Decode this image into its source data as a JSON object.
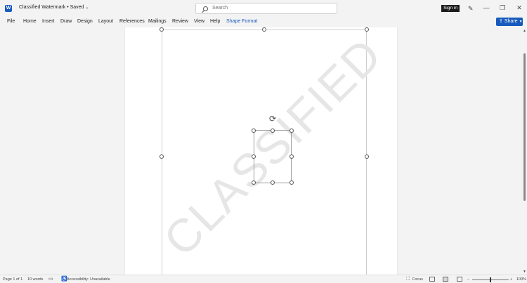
{
  "titlebar": {
    "doc_title": "Classified Watermark • Saved",
    "search_placeholder": "Search",
    "signin_label": "Sign in",
    "minimize": "—",
    "restore": "❐",
    "close": "✕"
  },
  "ribbon": {
    "tabs": [
      "File",
      "Home",
      "Insert",
      "Draw",
      "Design",
      "Layout",
      "References",
      "Mailings",
      "Review",
      "View",
      "Help",
      "Shape Format"
    ],
    "active_tab": "Shape Format",
    "share_label": "Share"
  },
  "document": {
    "watermark_text": "CLASSIFIED"
  },
  "statusbar": {
    "page": "Page 1 of 1",
    "words": "10 words",
    "accessibility": "Accessibility: Unavailable",
    "focus": "Focus",
    "zoom": "100%"
  },
  "colors": {
    "accent": "#185abd",
    "watermark": "#e6e6e6"
  }
}
